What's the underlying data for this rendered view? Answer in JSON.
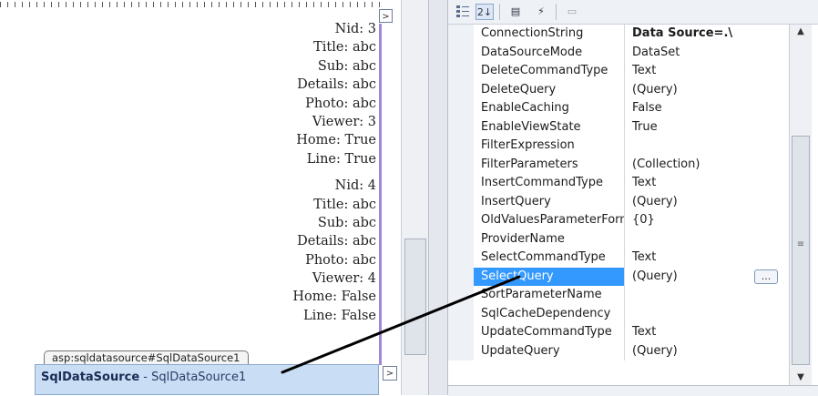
{
  "designer": {
    "records": [
      {
        "lines": [
          "Nid: 3",
          "Title: abc",
          "Sub: abc",
          "Details: abc",
          "Photo: abc",
          "Viewer: 3",
          "Home: True",
          "Line: True"
        ]
      },
      {
        "lines": [
          "Nid: 4",
          "Title: abc",
          "Sub: abc",
          "Details: abc",
          "Photo: abc",
          "Viewer: 4",
          "Home: False",
          "Line: False"
        ]
      }
    ],
    "smart_tag_glyph": ">",
    "control_tag": "asp:sqldatasource#SqlDataSource1",
    "control_type": "SqlDataSource",
    "control_separator": " - ",
    "control_id": "SqlDataSource1"
  },
  "toolbar": {
    "categorized_icon": "categorized-icon",
    "alphabetical_glyph": "2↓",
    "properties_glyph": "▤",
    "events_glyph": "⚡",
    "pages_glyph": "▭"
  },
  "properties": {
    "rows": [
      {
        "name": "ConnectionString",
        "value": "Data Source=.\\",
        "bold": true
      },
      {
        "name": "DataSourceMode",
        "value": "DataSet"
      },
      {
        "name": "DeleteCommandType",
        "value": "Text"
      },
      {
        "name": "DeleteQuery",
        "value": "(Query)"
      },
      {
        "name": "EnableCaching",
        "value": "False"
      },
      {
        "name": "EnableViewState",
        "value": "True"
      },
      {
        "name": "FilterExpression",
        "value": ""
      },
      {
        "name": "FilterParameters",
        "value": "(Collection)"
      },
      {
        "name": "InsertCommandType",
        "value": "Text"
      },
      {
        "name": "InsertQuery",
        "value": "(Query)"
      },
      {
        "name": "OldValuesParameterFormatString",
        "value": "{0}"
      },
      {
        "name": "ProviderName",
        "value": ""
      },
      {
        "name": "SelectCommandType",
        "value": "Text"
      },
      {
        "name": "SelectQuery",
        "value": "(Query)",
        "selected": true,
        "ellipsis": "..."
      },
      {
        "name": "SortParameterName",
        "value": ""
      },
      {
        "name": "SqlCacheDependency",
        "value": ""
      },
      {
        "name": "UpdateCommandType",
        "value": "Text"
      },
      {
        "name": "UpdateQuery",
        "value": "(Query)"
      }
    ],
    "scroll_up": "▲",
    "scroll_down": "▼",
    "scroll_grip": "≡"
  },
  "colors": {
    "selection": "#3399ff",
    "component_fill": "#c9ddf4",
    "edge": "#a285d6"
  }
}
